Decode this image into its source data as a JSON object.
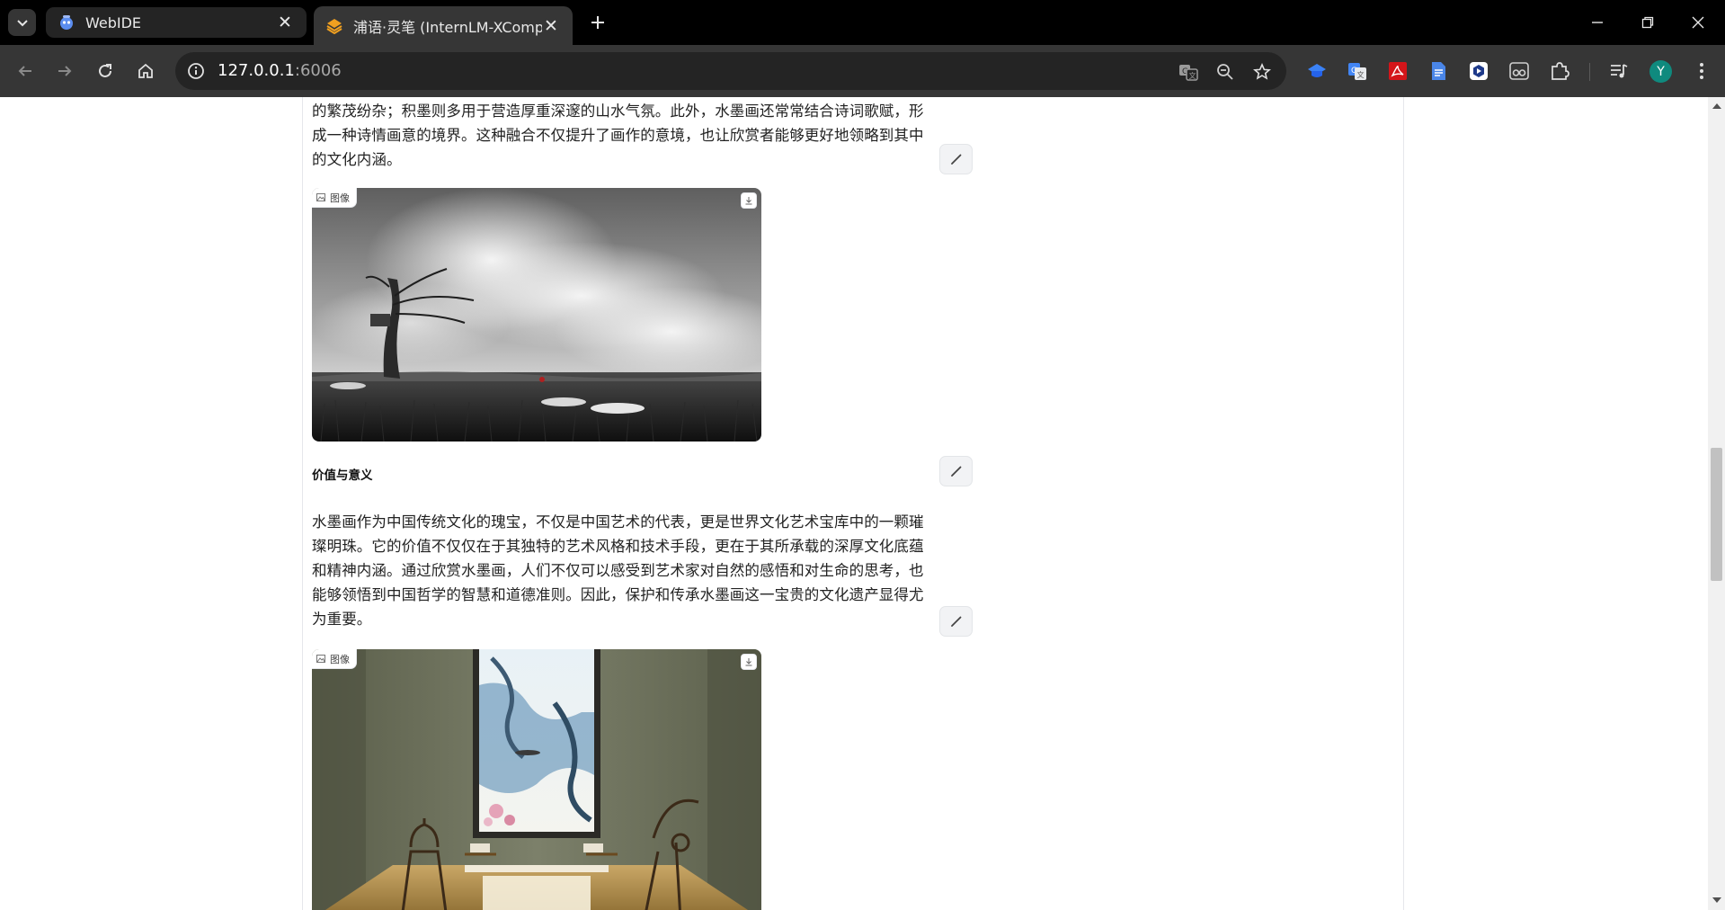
{
  "browser": {
    "tabs": [
      {
        "title": "WebIDE",
        "active": false
      },
      {
        "title": "浦语·灵笔 (InternLM-XCompo",
        "active": true
      }
    ],
    "url": {
      "host": "127.0.0.1",
      "port": ":6006"
    },
    "profile_initial": "Y",
    "accent_colors": {
      "tab_bar": "#000000",
      "toolbar": "#363636",
      "avatar": "#0f8a7e"
    }
  },
  "article": {
    "para_top": [
      "的繁茂纷杂；积墨则多用于营造厚重深邃的山水气氛。此外，水墨画还常常结合诗词歌赋，形",
      "成一种诗情画意的境界。这种融合不仅提升了画作的意境，也让欣赏者能够更好地领略到其中",
      "的文化内涵。"
    ],
    "image_label": "图像",
    "section_heading": "价值与意义",
    "para_value": [
      "水墨画作为中国传统文化的瑰宝，不仅是中国艺术的代表，更是世界文化艺术宝库中的一颗璀",
      "璨明珠。它的价值不仅仅在于其独特的艺术风格和技术手段，更在于其所承载的深厚文化底蕴",
      "和精神内涵。通过欣赏水墨画，人们不仅可以感受到艺术家对自然的感悟和对生命的思考，也",
      "能够领悟到中国哲学的智慧和道德准则。因此，保护和传承水墨画这一宝贵的文化遗产显得尤",
      "为重要。"
    ]
  }
}
